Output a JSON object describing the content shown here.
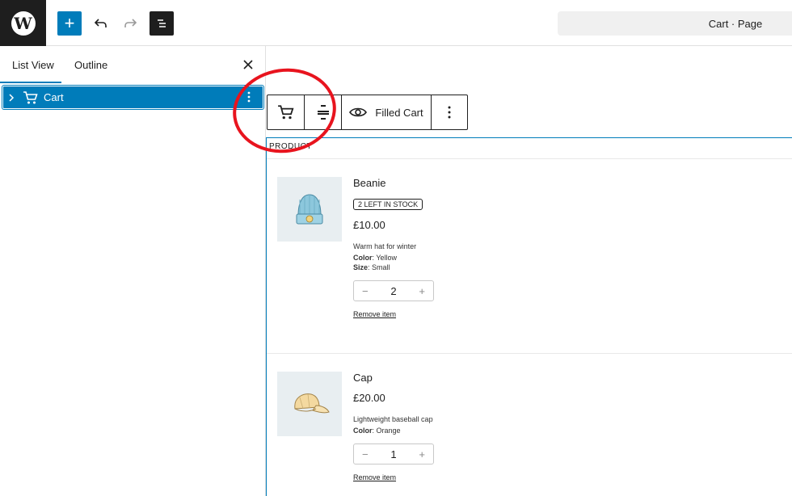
{
  "topbar": {
    "add_label": "+",
    "document_title": "Cart · Page"
  },
  "sidebar": {
    "tabs": [
      {
        "label": "List View",
        "active": true
      },
      {
        "label": "Outline",
        "active": false
      }
    ],
    "tree": {
      "label": "Cart",
      "icon": "cart-icon"
    }
  },
  "toolbar": {
    "view_label": "Filled Cart"
  },
  "cart": {
    "header": "PRODUCT",
    "products": [
      {
        "name": "Beanie",
        "stock": "2 LEFT IN STOCK",
        "price": "£10.00",
        "description": "Warm hat for winter",
        "attrs": [
          {
            "key": "Color",
            "value": ": Yellow"
          },
          {
            "key": "Size",
            "value": ": Small"
          }
        ],
        "qty": "2",
        "remove": "Remove item"
      },
      {
        "name": "Cap",
        "price": "£20.00",
        "description": "Lightweight baseball cap",
        "attrs": [
          {
            "key": "Color",
            "value": ": Orange"
          }
        ],
        "qty": "1",
        "remove": "Remove item"
      }
    ]
  },
  "colors": {
    "accent": "#007cba",
    "annotation": "#e8141e",
    "dark": "#1e1e1e"
  }
}
